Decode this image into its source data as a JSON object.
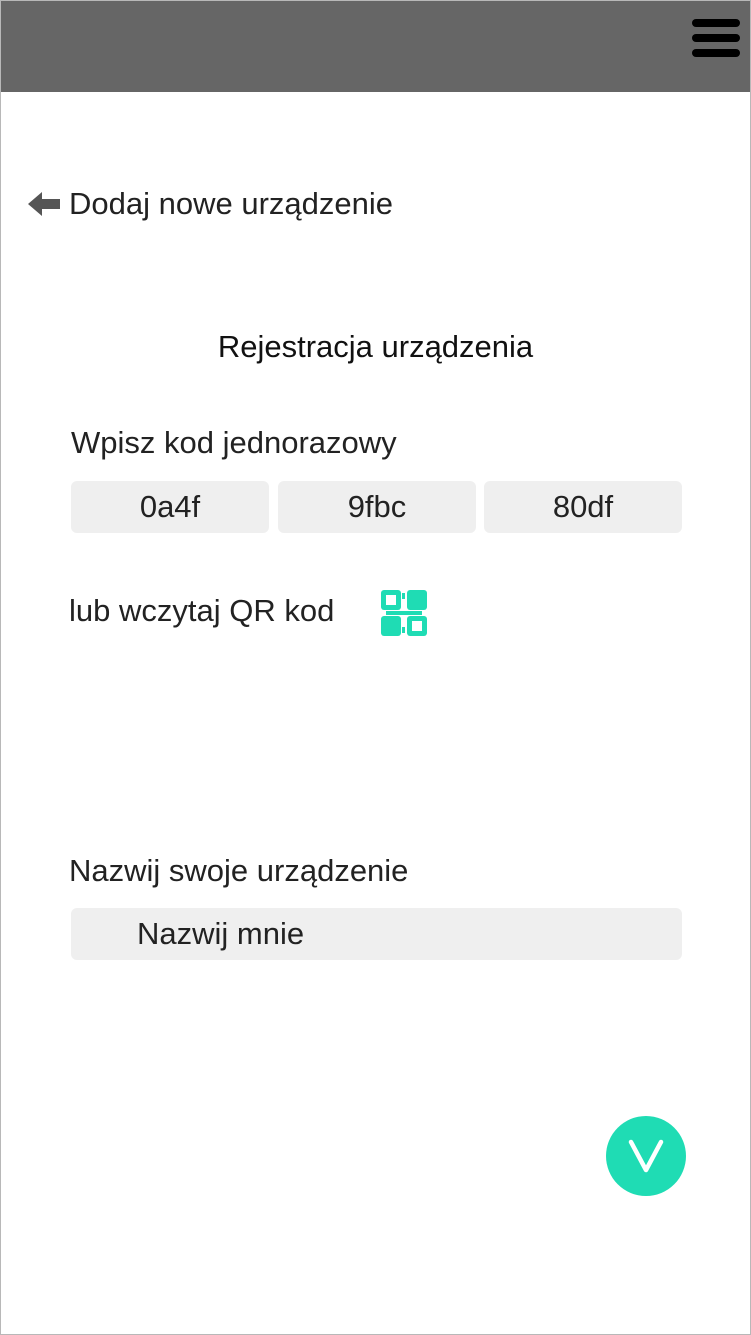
{
  "header": {
    "menu_icon": "hamburger-menu-icon"
  },
  "navigation": {
    "back_icon": "arrow-left-icon",
    "title": "Dodaj nowe urządzenie"
  },
  "registration": {
    "section_title": "Rejestracja urządzenia",
    "code_label": "Wpisz kod jednorazowy",
    "code_segments": [
      "0a4f",
      "9fbc",
      "80df"
    ],
    "qr_label": "lub wczytaj QR kod",
    "qr_icon": "qr-code-icon",
    "name_label": "Nazwij swoje urządzenie",
    "name_value": "Nazwij mnie"
  },
  "actions": {
    "confirm_icon": "checkmark-v-icon"
  },
  "colors": {
    "header_bg": "#666666",
    "accent": "#1fdcb4",
    "field_bg": "#efefef"
  }
}
